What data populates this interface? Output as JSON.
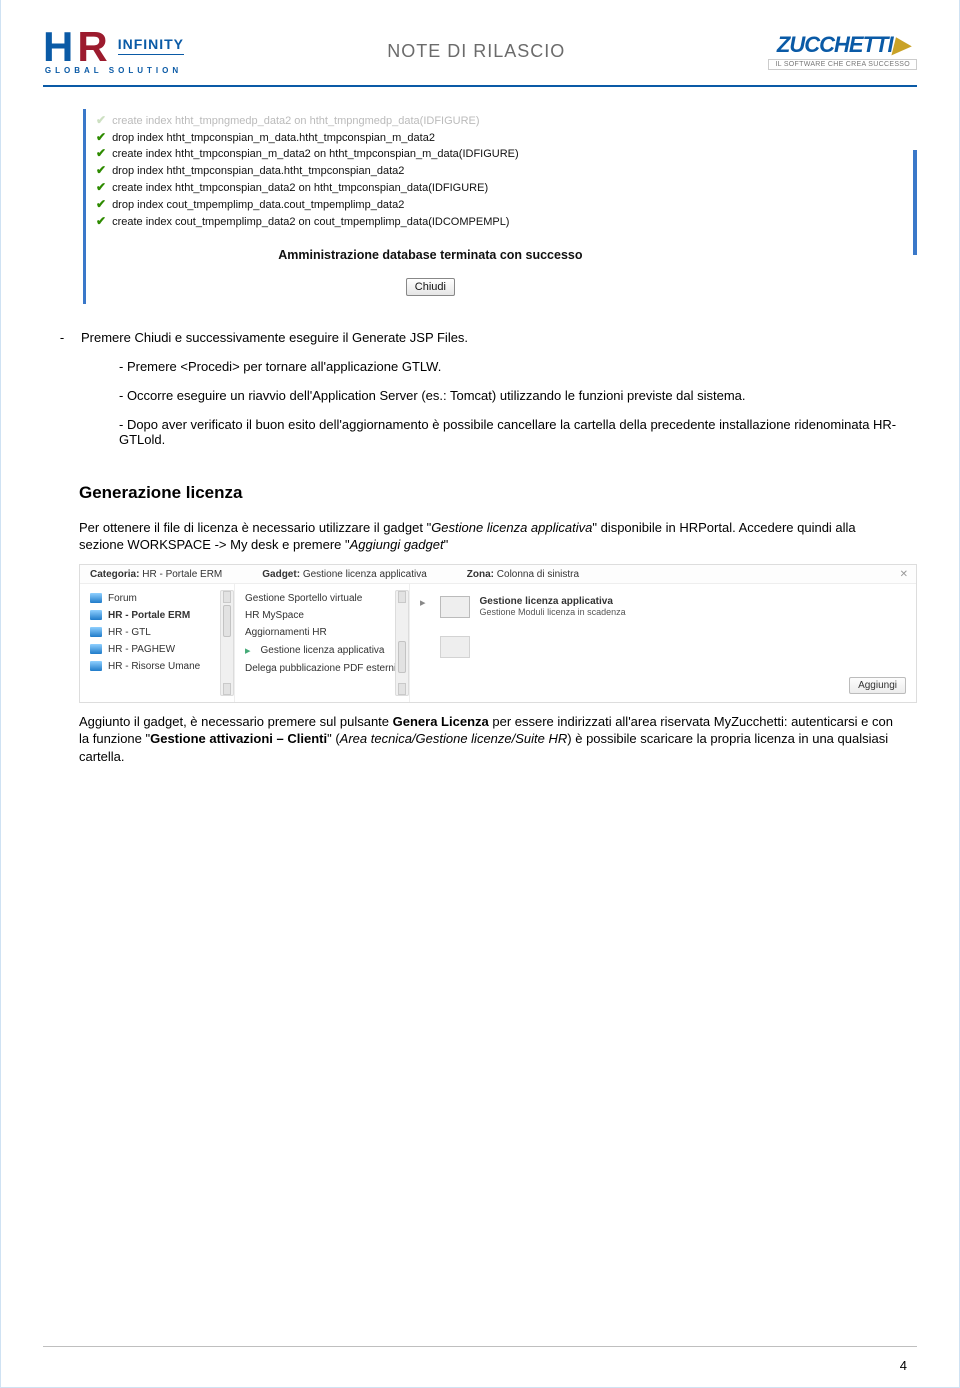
{
  "header": {
    "logo_main": "INFINITY",
    "logo_sub": "GLOBAL SOLUTION",
    "center_title": "NOTE DI RILASCIO",
    "zuc_name": "ZUCCHETTI",
    "zuc_tagline": "IL SOFTWARE CHE CREA SUCCESSO"
  },
  "db_box": {
    "line_cut": "create index htht_tmpngmedp_data2 on htht_tmpngmedp_data(IDFIGURE)",
    "steps": [
      "drop index htht_tmpconspian_m_data.htht_tmpconspian_m_data2",
      "create index htht_tmpconspian_m_data2 on htht_tmpconspian_m_data(IDFIGURE)",
      "drop index htht_tmpconspian_data.htht_tmpconspian_data2",
      "create index htht_tmpconspian_data2 on htht_tmpconspian_data(IDFIGURE)",
      "drop index cout_tmpemplimp_data.cout_tmpemplimp_data2",
      "create index cout_tmpemplimp_data2 on cout_tmpemplimp_data(IDCOMPEMPL)"
    ],
    "success": "Amministrazione database terminata con successo",
    "close": "Chiudi"
  },
  "body": {
    "item1": "Premere Chiudi e successivamente eseguire  il Generate JSP Files.",
    "item2": "- Premere <Procedi> per tornare all'applicazione GTLW.",
    "item3": "- Occorre eseguire un riavvio dell'Application Server (es.: Tomcat) utilizzando le funzioni previste dal sistema.",
    "item4": "- Dopo aver verificato il buon esito dell'aggiornamento è possibile cancellare la cartella della precedente installazione ridenominata HR-GTLold."
  },
  "section": {
    "title": "Generazione licenza",
    "p1_pre": "Per ottenere il file di licenza è necessario utilizzare il gadget \"",
    "p1_em": "Gestione licenza applicativa",
    "p1_mid": "\" disponibile in HRPortal. Accedere quindi alla sezione WORKSPACE -> My desk e premere \"",
    "p1_em2": "Aggiungi gadget",
    "p1_post": "\""
  },
  "gadget": {
    "cat_label": "Categoria:",
    "cat_val": "HR - Portale ERM",
    "gadget_label": "Gadget:",
    "gadget_val": "Gestione licenza applicativa",
    "zona_label": "Zona:",
    "zona_val": "Colonna di sinistra",
    "colA": [
      {
        "label": "Forum",
        "sel": false
      },
      {
        "label": "HR - Portale ERM",
        "sel": true
      },
      {
        "label": "HR - GTL",
        "sel": false
      },
      {
        "label": "HR - PAGHEW",
        "sel": false
      },
      {
        "label": "HR - Risorse Umane",
        "sel": false
      }
    ],
    "colB": [
      {
        "label": "Gestione Sportello virtuale",
        "sel": false
      },
      {
        "label": "HR MySpace",
        "sel": false
      },
      {
        "label": "Aggiornamenti HR",
        "sel": false
      },
      {
        "label": "Gestione licenza applicativa",
        "sel": true
      },
      {
        "label": "Delega pubblicazione PDF esterni",
        "sel": false
      }
    ],
    "preview_title": "Gestione licenza applicativa",
    "preview_sub": "Gestione Moduli licenza in scadenza",
    "add_btn": "Aggiungi"
  },
  "after": {
    "pre": "Aggiunto il gadget, è necessario premere sul pulsante ",
    "b1": "Genera Licenza",
    "mid1": " per essere indirizzati all'area riservata MyZucchetti: autenticarsi e con la funzione \"",
    "b2": "Gestione attivazioni – Clienti",
    "mid2": "\" (",
    "em1": "Area tecnica/Gestione licenze/Suite HR",
    "post": ") è possibile scaricare la propria licenza in una qualsiasi cartella."
  },
  "page_number": "4"
}
